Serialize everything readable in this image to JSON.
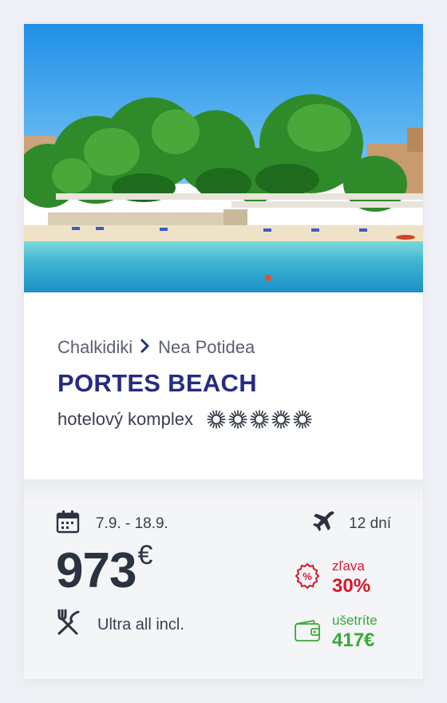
{
  "hotel": {
    "region": "Chalkidiki",
    "resort": "Nea Potidea",
    "name": "PORTES BEACH",
    "type": "hotelový komplex",
    "stars": 5
  },
  "trip": {
    "dates": "7.9. - 18.9.",
    "duration": "12 dní",
    "price": "973",
    "currency": "€",
    "board": "Ultra all incl."
  },
  "discount": {
    "label": "zľava",
    "value": "30%"
  },
  "savings": {
    "label": "ušetríte",
    "value": "417€"
  },
  "colors": {
    "title": "#262b84",
    "discount": "#d7182a",
    "savings": "#3aa838",
    "price": "#2b3340"
  },
  "icons": [
    "chevron-right-icon",
    "star-icon",
    "calendar-icon",
    "airplane-icon",
    "cutlery-icon",
    "percent-badge-icon",
    "wallet-icon"
  ]
}
